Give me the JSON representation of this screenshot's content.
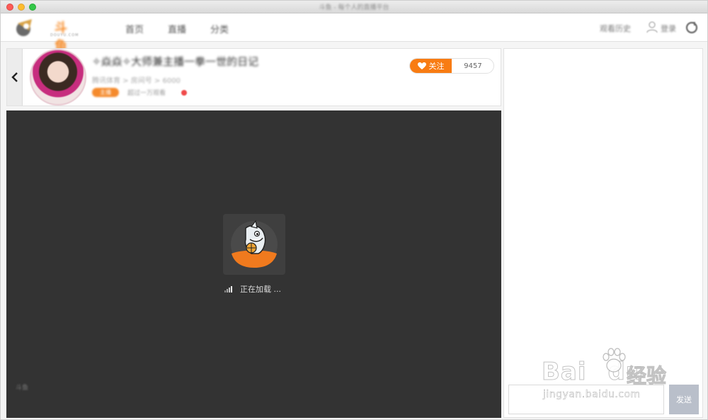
{
  "window": {
    "title": "斗鱼 - 每个人的直播平台"
  },
  "nav": {
    "logo_text": "斗鱼",
    "logo_sub": "DOUYU.COM",
    "items": [
      {
        "label": "首页"
      },
      {
        "label": "直播"
      },
      {
        "label": "分类"
      }
    ],
    "history_label": "观看历史",
    "login_label": "登录"
  },
  "room": {
    "title": "✧焱焱✧大师兼主播一拳一世的日记",
    "meta": "腾讯体育 > 房间号 > 6000",
    "tag": "主播",
    "sub": "超过一万观看",
    "follow_label": "关注",
    "follow_count": "9457"
  },
  "player": {
    "loading_text": "正在加载 ...",
    "corner_text": "斗鱼"
  },
  "chat": {
    "input_placeholder": "",
    "send_label": "发送"
  },
  "watermark": {
    "brand": "Bai",
    "brand_tail": "du",
    "cn": "经验",
    "url": "jingyan.baidu.com"
  },
  "colors": {
    "accent": "#f87c13",
    "player_bg": "#333333",
    "send_btn": "#b9bfca"
  }
}
